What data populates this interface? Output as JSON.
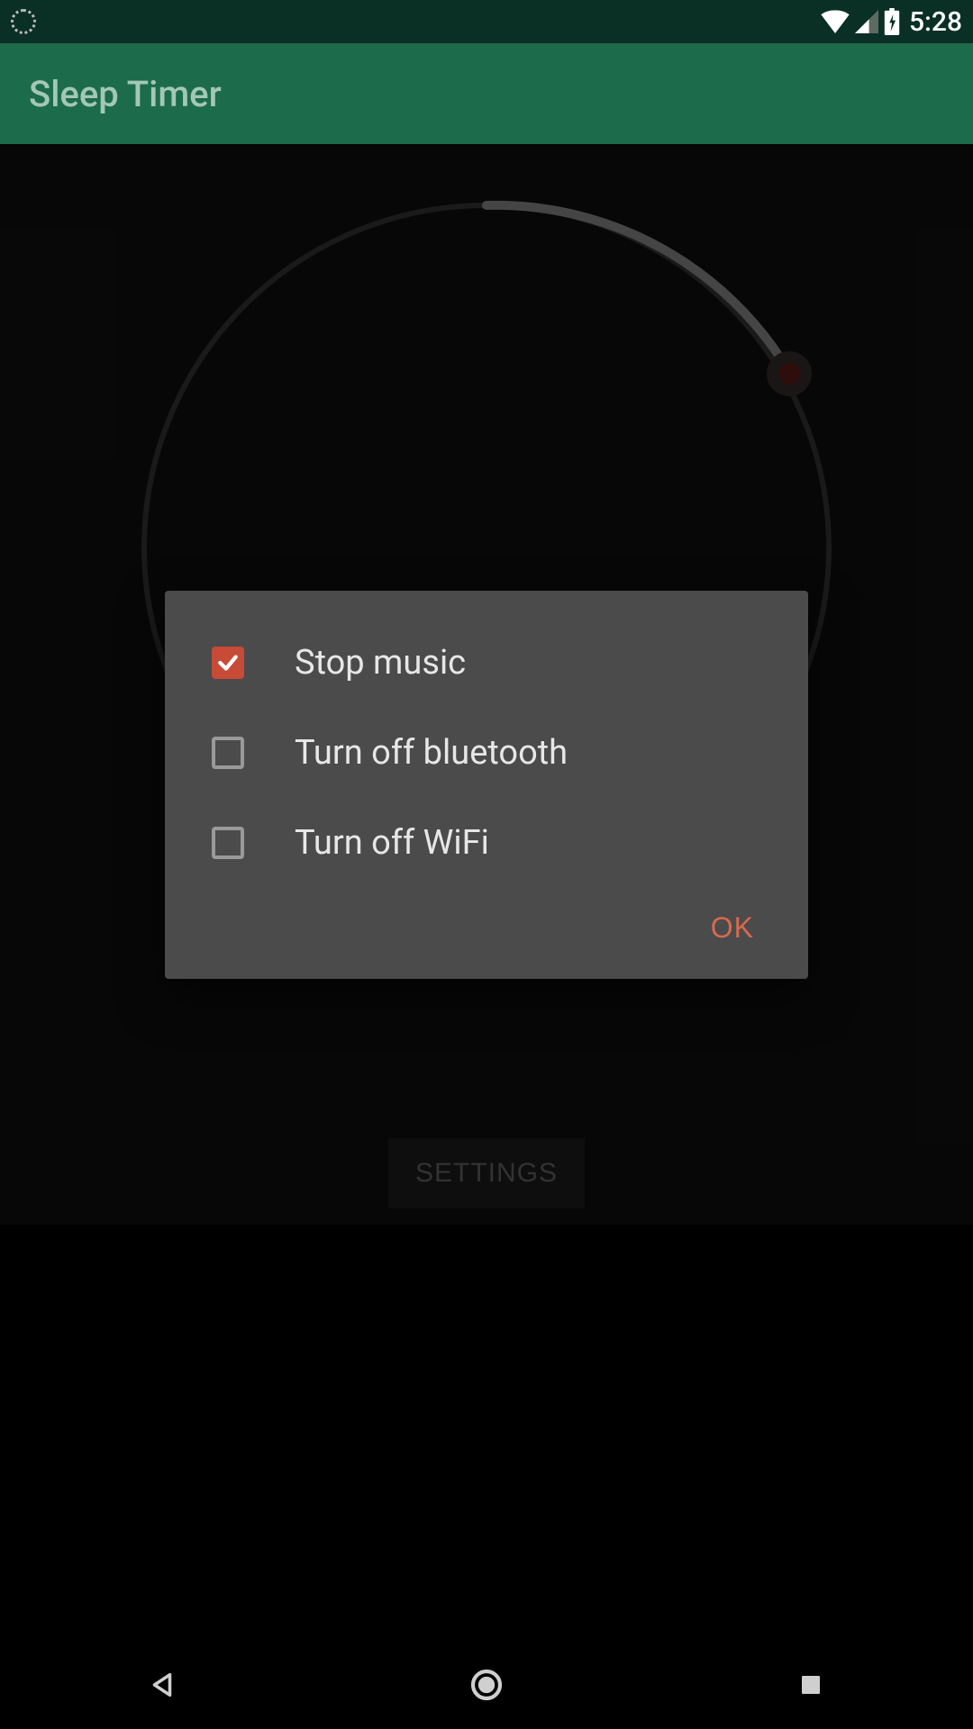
{
  "status_bar": {
    "time": "5:28"
  },
  "app_bar": {
    "title": "Sleep Timer"
  },
  "dialog": {
    "options": [
      {
        "label": "Stop music",
        "checked": true
      },
      {
        "label": "Turn off bluetooth",
        "checked": false
      },
      {
        "label": "Turn off WiFi",
        "checked": false
      }
    ],
    "ok_label": "OK"
  },
  "buttons": {
    "settings_label": "SETTINGS"
  },
  "colors": {
    "accent": "#d86a4e",
    "app_bar": "#1c6b4a",
    "status_bar": "#0a3025",
    "checkbox_checked": "#c74b36"
  }
}
